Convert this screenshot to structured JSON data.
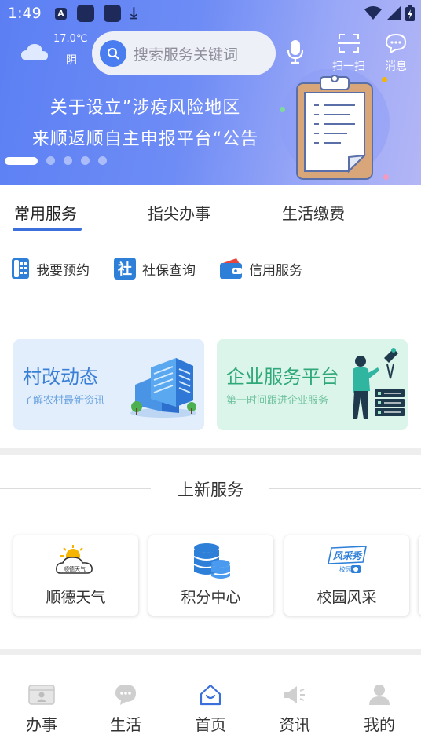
{
  "status_bar": {
    "time": "1:49",
    "notification_badge": "A"
  },
  "weather": {
    "temperature": "17.0℃",
    "condition": "阴"
  },
  "search": {
    "placeholder": "搜索服务关键词"
  },
  "header_actions": {
    "scan_label": "扫一扫",
    "message_label": "消息"
  },
  "banner": {
    "line1": "关于设立”涉疫风险地区",
    "line2": "来顺返顺自主申报平台“公告",
    "slide_count": 5,
    "active_slide": 1
  },
  "tabs": [
    {
      "label": "常用服务",
      "active": true
    },
    {
      "label": "指尖办事",
      "active": false
    },
    {
      "label": "生活缴费",
      "active": false
    }
  ],
  "quick_services": [
    {
      "label": "我要预约",
      "icon": "phone-booking-icon"
    },
    {
      "label": "社保查询",
      "icon": "social-security-icon"
    },
    {
      "label": "信用服务",
      "icon": "credit-wallet-icon"
    }
  ],
  "promo_cards": [
    {
      "title": "村改动态",
      "subtitle": "了解农村最新资讯",
      "icon": "buildings-icon"
    },
    {
      "title": "企业服务平台",
      "subtitle": "第一时间跟进企业服务",
      "icon": "server-rack-icon"
    }
  ],
  "new_services": {
    "title": "上新服务",
    "items": [
      {
        "label": "顺德天气",
        "icon": "weather-icon",
        "icon_text": "顺德天气"
      },
      {
        "label": "积分中心",
        "icon": "points-coins-icon"
      },
      {
        "label": "校园风采",
        "icon": "campus-style-icon",
        "icon_text": "风采秀",
        "icon_subtext": "校园"
      }
    ]
  },
  "bottom_nav": [
    {
      "label": "办事",
      "icon": "id-card-icon",
      "active": false
    },
    {
      "label": "生活",
      "icon": "chat-bubble-icon",
      "active": false
    },
    {
      "label": "首页",
      "icon": "home-icon",
      "active": true
    },
    {
      "label": "资讯",
      "icon": "megaphone-icon",
      "active": false
    },
    {
      "label": "我的",
      "icon": "user-icon",
      "active": false
    }
  ],
  "colors": {
    "primary": "#3a6fdc",
    "hero_start": "#5b7ff3",
    "hero_end": "#b3b6f6",
    "card_blue_bg": "#e2eefc",
    "card_green_bg": "#dcf5ea"
  }
}
